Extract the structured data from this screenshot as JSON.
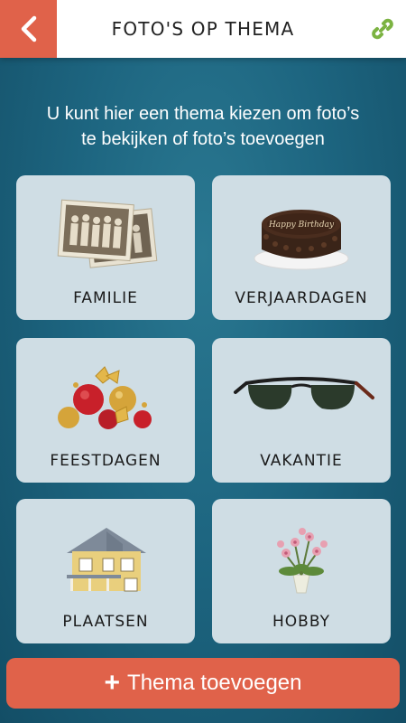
{
  "header": {
    "title": "FOTO'S OP THEMA",
    "back_icon": "chevron-left-icon",
    "link_icon": "link-icon",
    "accent": "#e0624a",
    "link_color": "#7cb342"
  },
  "intro": {
    "line1": "U kunt hier een thema kiezen om foto’s",
    "line2": "te bekijken of foto’s toevoegen"
  },
  "themes": [
    {
      "label": "FAMILIE",
      "icon": "old-photos-icon"
    },
    {
      "label": "VERJAARDAGEN",
      "icon": "birthday-cake-icon"
    },
    {
      "label": "FEESTDAGEN",
      "icon": "christmas-ornaments-icon"
    },
    {
      "label": "VAKANTIE",
      "icon": "sunglasses-icon"
    },
    {
      "label": "PLAATSEN",
      "icon": "house-icon"
    },
    {
      "label": "HOBBY",
      "icon": "flower-pot-icon"
    }
  ],
  "cake_text": "Happy Birthday",
  "add_button": {
    "label": "Thema toevoegen",
    "icon": "plus-icon"
  }
}
